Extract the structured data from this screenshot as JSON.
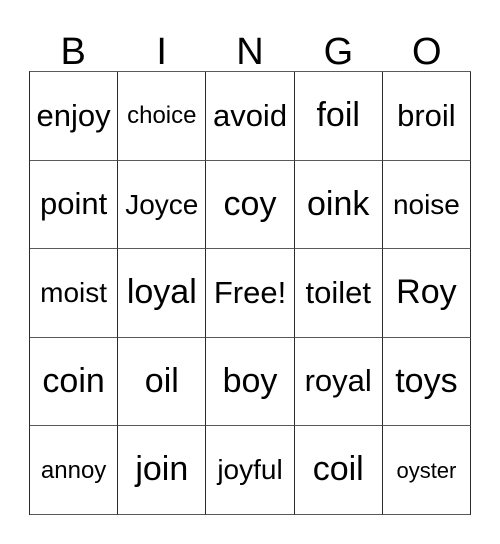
{
  "card": {
    "type": "bingo-card",
    "headers": [
      "B",
      "I",
      "N",
      "G",
      "O"
    ],
    "free_space": "Free!",
    "rows": [
      [
        {
          "text": "enjoy",
          "size": "fs-lg"
        },
        {
          "text": "choice",
          "size": "fs-sm"
        },
        {
          "text": "avoid",
          "size": "fs-lg"
        },
        {
          "text": "foil",
          "size": "fs-xl"
        },
        {
          "text": "broil",
          "size": "fs-lg"
        }
      ],
      [
        {
          "text": "point",
          "size": "fs-lg"
        },
        {
          "text": "Joyce",
          "size": "fs-md"
        },
        {
          "text": "coy",
          "size": "fs-xl"
        },
        {
          "text": "oink",
          "size": "fs-xl"
        },
        {
          "text": "noise",
          "size": "fs-md"
        }
      ],
      [
        {
          "text": "moist",
          "size": "fs-md"
        },
        {
          "text": "loyal",
          "size": "fs-xl"
        },
        {
          "text": "Free!",
          "size": "fs-lg"
        },
        {
          "text": "toilet",
          "size": "fs-lg"
        },
        {
          "text": "Roy",
          "size": "fs-xl"
        }
      ],
      [
        {
          "text": "coin",
          "size": "fs-xl"
        },
        {
          "text": "oil",
          "size": "fs-xl"
        },
        {
          "text": "boy",
          "size": "fs-xl"
        },
        {
          "text": "royal",
          "size": "fs-lg"
        },
        {
          "text": "toys",
          "size": "fs-xl"
        }
      ],
      [
        {
          "text": "annoy",
          "size": "fs-sm"
        },
        {
          "text": "join",
          "size": "fs-xl"
        },
        {
          "text": "joyful",
          "size": "fs-md"
        },
        {
          "text": "coil",
          "size": "fs-xl"
        },
        {
          "text": "oyster",
          "size": "fs-xs"
        }
      ]
    ]
  }
}
